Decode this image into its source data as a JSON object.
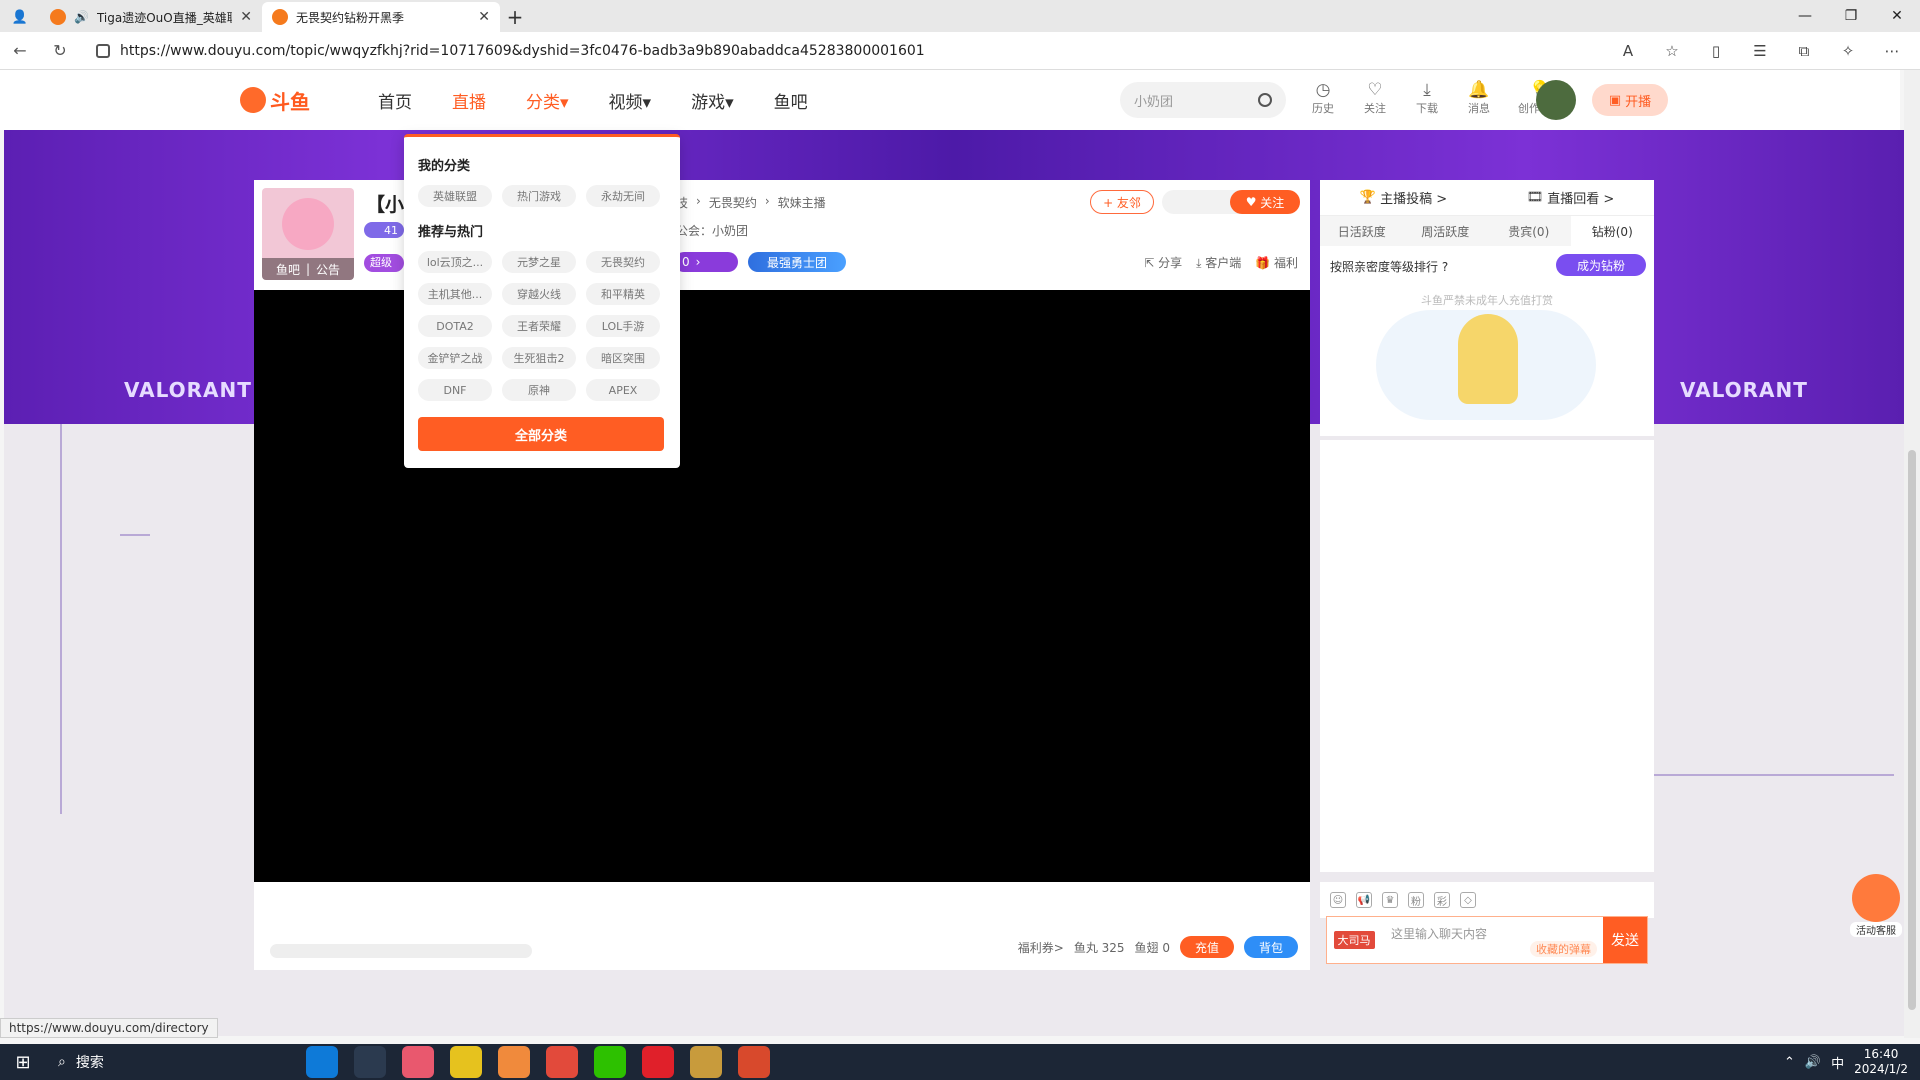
{
  "browser": {
    "tabs": [
      {
        "title": "Tiga遗迹OuO直播_英雄联盟",
        "active": false
      },
      {
        "title": "无畏契约钻粉开黑季",
        "active": true
      }
    ],
    "url": "https://www.douyu.com/topic/wwqyzfkhj?rid=10717609&dyshid=3fc0476-badb3a9b890abaddca45283800001601",
    "status_url": "https://www.douyu.com/directory"
  },
  "header": {
    "logo_text": "斗鱼",
    "nav": [
      {
        "label": "首页"
      },
      {
        "label": "直播"
      },
      {
        "label": "分类"
      },
      {
        "label": "视频"
      },
      {
        "label": "游戏"
      },
      {
        "label": "鱼吧"
      }
    ],
    "search_placeholder": "小奶团",
    "icons": [
      {
        "label": "历史",
        "icon": "history-icon"
      },
      {
        "label": "关注",
        "icon": "heart-icon"
      },
      {
        "label": "下载",
        "icon": "download-icon"
      },
      {
        "label": "消息",
        "icon": "bell-icon"
      },
      {
        "label": "创作中心",
        "icon": "bulb-icon"
      }
    ],
    "kaibo_label": "开播"
  },
  "banner": {
    "brand_left": "VALORANT",
    "brand_right": "VALORANT"
  },
  "room": {
    "title": "【小",
    "level": "41",
    "super_badge": "超级",
    "avatar_labels": [
      "鱼吧",
      "公告"
    ],
    "crumbs": [
      "技",
      "无畏契约",
      "软妹主播"
    ],
    "guild": "公会：小奶团",
    "war_count": "0",
    "brave_label": "最强勇士团",
    "friend_label": "+ 友邻",
    "follow_label": "关注",
    "actions": [
      "分享",
      "客户端",
      "福利"
    ]
  },
  "player_bottom": {
    "welfare": "福利券>",
    "fish_ball": "鱼丸 325",
    "fish_fin": "鱼翅 0",
    "recharge": "充值",
    "bag": "背包"
  },
  "right_panel": {
    "top_links": [
      "主播投稿 >",
      "直播回看 >"
    ],
    "tabs": [
      "日活跃度",
      "周活跃度",
      "贵宾(0)",
      "钻粉(0)"
    ],
    "rank_label": "按照亲密度等级排行",
    "become_label": "成为钻粉",
    "minor_note": "斗鱼严禁未成年人充值打赏",
    "chat_placeholder": "这里输入聊天内容",
    "noble_label": "大司马",
    "fav_danmu": "收藏的弹幕",
    "send": "发送",
    "service_label": "活动客服"
  },
  "dropdown": {
    "my_title": "我的分类",
    "my_items": [
      "英雄联盟",
      "热门游戏",
      "永劫无间"
    ],
    "hot_title": "推荐与热门",
    "hot_items": [
      "lol云顶之...",
      "元梦之星",
      "无畏契约",
      "主机其他...",
      "穿越火线",
      "和平精英",
      "DOTA2",
      "王者荣耀",
      "LOL手游",
      "金铲铲之战",
      "生死狙击2",
      "暗区突围",
      "DNF",
      "原神",
      "APEX"
    ],
    "all_label": "全部分类"
  },
  "taskbar": {
    "search_label": "搜索",
    "time": "16:40",
    "date": "2024/1/2",
    "ime": "中"
  }
}
